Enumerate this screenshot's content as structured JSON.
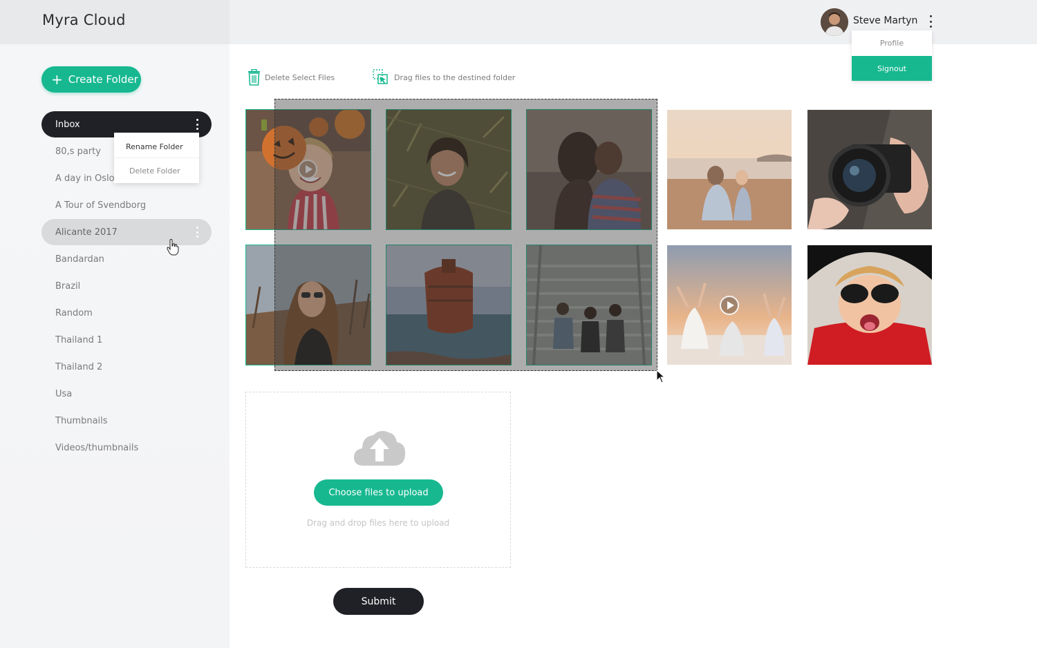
{
  "app": {
    "title": "Myra Cloud"
  },
  "user": {
    "name": "Steve Martyn",
    "menu": {
      "profile": "Profile",
      "signout": "Signout"
    }
  },
  "sidebar": {
    "create_label": "Create Folder",
    "folders": [
      {
        "label": "Inbox",
        "state": "active"
      },
      {
        "label": "80,s party"
      },
      {
        "label": "A day in Oslo"
      },
      {
        "label": "A Tour of Svendborg"
      },
      {
        "label": "Alicante 2017",
        "state": "hover"
      },
      {
        "label": "Bandardan"
      },
      {
        "label": "Brazil"
      },
      {
        "label": "Random"
      },
      {
        "label": "Thailand 1"
      },
      {
        "label": "Thailand 2"
      },
      {
        "label": "Usa"
      },
      {
        "label": "Thumbnails"
      },
      {
        "label": "Videos/thumbnails"
      }
    ],
    "context_menu": {
      "rename": "Rename Folder",
      "delete": "Delete Folder"
    }
  },
  "toolbar": {
    "delete_label": "Delete Select Files",
    "drag_label": "Drag files to the destined folder"
  },
  "gallery": {
    "items": [
      {
        "subject": "girl-with-pumpkin",
        "type": "video",
        "selected": true
      },
      {
        "subject": "woman-in-grass",
        "type": "photo",
        "selected": true
      },
      {
        "subject": "couple-embracing",
        "type": "photo",
        "selected": true
      },
      {
        "subject": "mother-and-child-on-beach",
        "type": "photo",
        "selected": false
      },
      {
        "subject": "hands-holding-camera",
        "type": "photo",
        "selected": false
      },
      {
        "subject": "woman-with-sunglasses",
        "type": "photo",
        "selected": true
      },
      {
        "subject": "shipwreck-at-sea",
        "type": "photo",
        "selected": true
      },
      {
        "subject": "friends-on-stairs",
        "type": "photo",
        "selected": true
      },
      {
        "subject": "dancers-at-sunset",
        "type": "video",
        "selected": false
      },
      {
        "subject": "girl-with-halloween-mask",
        "type": "photo",
        "selected": false
      }
    ]
  },
  "upload": {
    "button_label": "Choose files to upload",
    "hint": "Drag and drop files here to upload"
  },
  "submit_label": "Submit",
  "colors": {
    "accent": "#17b890",
    "dark": "#1f2126"
  },
  "icons": {
    "trash": "trash-icon",
    "drag": "drag-select-icon",
    "cloud": "cloud-upload-icon",
    "kebab": "more-vertical-icon",
    "play": "play-icon"
  }
}
